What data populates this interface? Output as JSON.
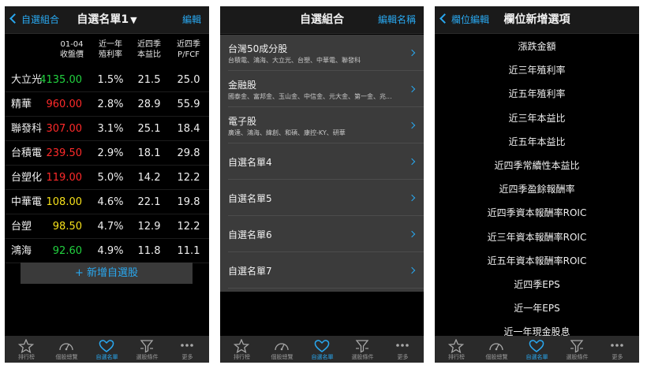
{
  "panel1": {
    "nav": {
      "title": "自選名單1",
      "left": "自選組合",
      "right": "編輯"
    },
    "headers": [
      {
        "l1": "01-04",
        "l2": "收盤價"
      },
      {
        "l1": "近一年",
        "l2": "殖利率"
      },
      {
        "l1": "近四季",
        "l2": "本益比"
      },
      {
        "l1": "近四季",
        "l2": "P/FCF"
      }
    ],
    "rows": [
      {
        "name": "大立光",
        "price": "4135.00",
        "color": "#22d13f",
        "yield": "1.5%",
        "pe": "21.5",
        "pfcf": "25.0"
      },
      {
        "name": "精華",
        "price": "960.00",
        "color": "#ff2a2a",
        "yield": "2.8%",
        "pe": "28.9",
        "pfcf": "55.9"
      },
      {
        "name": "聯發科",
        "price": "307.00",
        "color": "#ff2a2a",
        "yield": "3.1%",
        "pe": "25.1",
        "pfcf": "18.4"
      },
      {
        "name": "台積電",
        "price": "239.50",
        "color": "#ff2a2a",
        "yield": "2.9%",
        "pe": "18.1",
        "pfcf": "29.8"
      },
      {
        "name": "台塑化",
        "price": "119.00",
        "color": "#ff2a2a",
        "yield": "5.0%",
        "pe": "14.2",
        "pfcf": "12.2"
      },
      {
        "name": "中華電",
        "price": "108.00",
        "color": "#f5e01a",
        "yield": "4.6%",
        "pe": "22.1",
        "pfcf": "19.8"
      },
      {
        "name": "台塑",
        "price": "98.50",
        "color": "#f5e01a",
        "yield": "4.7%",
        "pe": "12.9",
        "pfcf": "12.2"
      },
      {
        "name": "鴻海",
        "price": "92.60",
        "color": "#22d13f",
        "yield": "4.9%",
        "pe": "11.8",
        "pfcf": "11.1"
      }
    ],
    "add_button": "+ 新增自選股"
  },
  "panel2": {
    "nav": {
      "title": "自選組合",
      "right": "編輯名稱"
    },
    "items": [
      {
        "title": "台灣50成分股",
        "sub": "台積電、鴻海、大立光、台塑、中華電、聯發科"
      },
      {
        "title": "金融股",
        "sub": "國泰金、富邦金、玉山金、中信金、元大金、第一金、兆..."
      },
      {
        "title": "電子股",
        "sub": "廣達、鴻海、緯創、和碩、康控-KY、研華"
      },
      {
        "title": "自選名單4",
        "sub": ""
      },
      {
        "title": "自選名單5",
        "sub": ""
      },
      {
        "title": "自選名單6",
        "sub": ""
      },
      {
        "title": "自選名單7",
        "sub": ""
      }
    ]
  },
  "panel3": {
    "nav": {
      "title": "欄位新增選項",
      "left": "欄位編輯"
    },
    "options": [
      "漲跌金額",
      "近三年殖利率",
      "近五年殖利率",
      "近三年本益比",
      "近五年本益比",
      "近四季常續性本益比",
      "近四季盈餘報酬率",
      "近四季資本報酬率ROIC",
      "近三年資本報酬率ROIC",
      "近五年資本報酬率ROIC",
      "近四季EPS",
      "近一年EPS",
      "近一年現金股息"
    ]
  },
  "tabs": [
    {
      "label": "排行榜",
      "icon": "star-icon"
    },
    {
      "label": "個股總覽",
      "icon": "gauge-icon"
    },
    {
      "label": "自選名單",
      "icon": "heart-icon"
    },
    {
      "label": "選股條件",
      "icon": "funnel-icon"
    },
    {
      "label": "更多",
      "icon": "more-icon"
    }
  ],
  "colors": {
    "accent": "#29a8f0",
    "up": "#ff2a2a",
    "down": "#22d13f",
    "flat": "#f5e01a"
  }
}
